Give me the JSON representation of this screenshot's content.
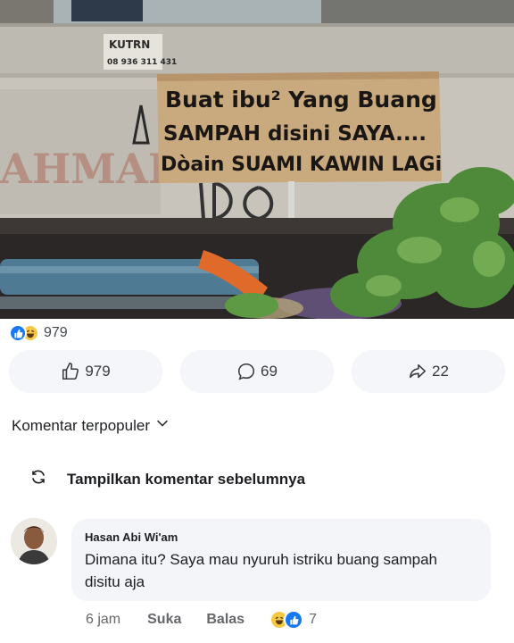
{
  "photo": {
    "sign_line1": "Buat ibu² Yang Buang",
    "sign_line2": "SAMPAH disini SAYA....",
    "sign_line3": "Dòain SUAMI KAWIN LAGi",
    "sticker_line1": "KUTRN",
    "sticker_line2": "08 936 311 431",
    "graffiti": "AHMAD"
  },
  "reactions": {
    "count": "979"
  },
  "actions": {
    "like_count": "979",
    "comment_count": "69",
    "share_count": "22"
  },
  "comments_section": {
    "sort_label": "Komentar terpopuler",
    "previous_label": "Tampilkan komentar sebelumnya"
  },
  "comment": {
    "author": "Hasan Abi Wi'am",
    "text": "Dimana itu? Saya mau nyuruh istriku buang sampah disitu aja",
    "time": "6 jam",
    "like_label": "Suka",
    "reply_label": "Balas",
    "reaction_count": "7"
  },
  "colors": {
    "like_blue": "#1877f2",
    "haha_yellow": "#f7c843",
    "pill_bg": "#f5f6f9",
    "bubble_bg": "#f4f5f8",
    "meta_gray": "#65676b"
  },
  "icons": [
    "like-reaction-icon",
    "haha-reaction-icon",
    "thumbs-up-icon",
    "comment-icon",
    "share-icon",
    "chevron-down-icon",
    "refresh-icon"
  ]
}
